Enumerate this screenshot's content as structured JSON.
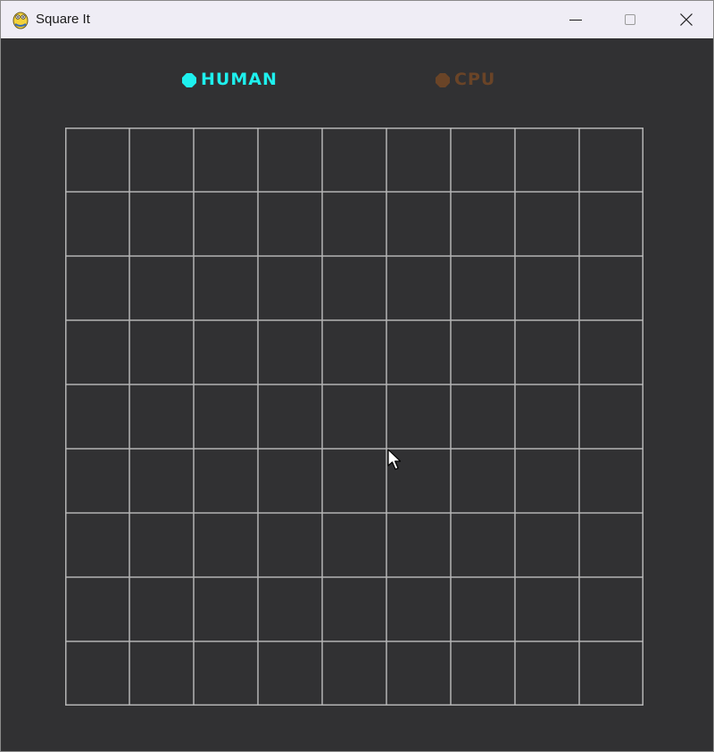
{
  "window": {
    "title": "Square It",
    "controls": [
      "minimize-icon",
      "maximize-icon",
      "close-icon"
    ]
  },
  "players": {
    "human": {
      "label": "HUMAN",
      "color": "#1ef0ee",
      "active": true
    },
    "cpu": {
      "label": "CPU",
      "color": "#6a4427",
      "active": false
    }
  },
  "board": {
    "rows": 9,
    "cols": 9,
    "line_color": "#b4b4b4",
    "background": "#313133"
  },
  "colors": {
    "app_background": "#313133",
    "titlebar_background": "#efedf5"
  }
}
